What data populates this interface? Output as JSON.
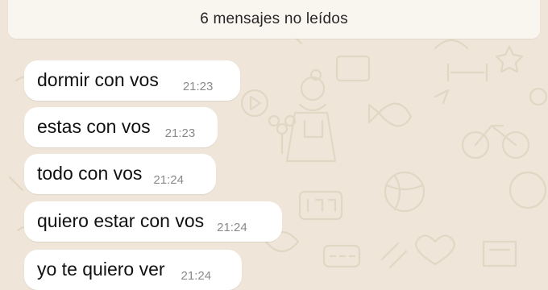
{
  "banner": {
    "text": "6 mensajes no leídos"
  },
  "messages": [
    {
      "text": "dormir con vos",
      "time": "21:23"
    },
    {
      "text": "estas con vos",
      "time": "21:23"
    },
    {
      "text": "todo con vos",
      "time": "21:24"
    },
    {
      "text": "quiero estar con vos",
      "time": "21:24"
    },
    {
      "text": "yo te quiero ver",
      "time": "21:24"
    }
  ],
  "colors": {
    "background": "#efe6d9",
    "bubble": "#ffffff",
    "timestamp": "#8a8a8a"
  },
  "wallpaper_icons": [
    "doodle-person-icon",
    "flower-icon",
    "fish-icon",
    "clock-icon",
    "ball-icon",
    "star-icon",
    "heart-icon",
    "play-icon",
    "bicycle-icon",
    "dumbbell-icon"
  ]
}
